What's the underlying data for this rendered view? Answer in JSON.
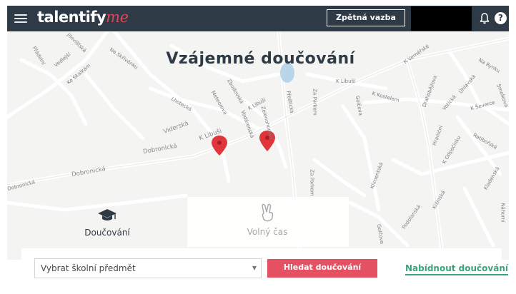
{
  "topbar": {
    "logo_main": "talentify",
    "logo_suffix": "me",
    "feedback_label": "Zpětná vazba",
    "help_label": "?"
  },
  "hero": {
    "title": "Vzájemné doučování"
  },
  "tabs": [
    {
      "label": "Doučování",
      "icon": "graduation-cap-icon",
      "active": true
    },
    {
      "label": "Volný čas",
      "icon": "peace-hand-icon",
      "active": false
    }
  ],
  "map": {
    "streets": [
      "K Libuši",
      "K Libuši",
      "K Libuši",
      "Dobronická",
      "Dobronická",
      "Dobronická",
      "Viderská",
      "Za Parkem",
      "Za Parkem",
      "K Kostelem",
      "Golčova",
      "Golčova",
      "Přeštická",
      "Zelenohorská",
      "Zbudovská",
      "Lhotecká",
      "Meteorova",
      "Vodárenská",
      "Jílovišťská",
      "K Vernéřské",
      "Na Rynku",
      "Úhlavská",
      "Smolkova",
      "Votická",
      "K Ševerce",
      "Kladenská",
      "Podolanská",
      "Kišínská",
      "Na Skřivánku",
      "Ke Skalkám",
      "Vedlejší",
      "Přádelní",
      "Drahobějlova",
      "Hraniční",
      "K Odpočinku",
      "Klimentská",
      "Ratibořská",
      "Náhorní"
    ],
    "marker_color": "#e0353b"
  },
  "search": {
    "subject_placeholder": "Vybrat školní předmět",
    "search_button": "Hledat doučování",
    "offer_link": "Nabídnout doučování"
  },
  "colors": {
    "header_bg": "#2e3a45",
    "accent_red": "#e35163",
    "accent_green": "#38a679",
    "map_bg": "#f4f4f2"
  }
}
